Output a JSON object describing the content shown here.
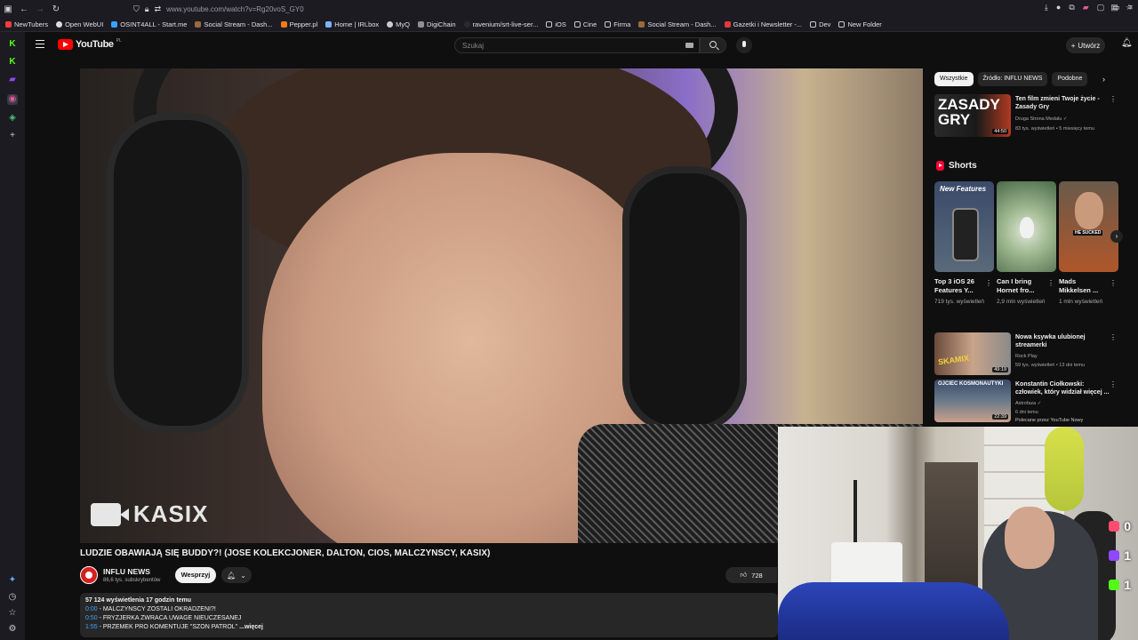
{
  "browser": {
    "url": "www.youtube.com/watch?v=Rg20voS_GY0",
    "bookmarks": [
      "NewTubers",
      "Open WebUI",
      "OSINT4ALL - Start.me",
      "Social Stream - Dash...",
      "Pepper.pl",
      "Home | IRLbox",
      "MyQ",
      "DigiChain",
      "ravenium/srt-live-ser...",
      "iOS",
      "Cine",
      "Firma",
      "Social Stream - Dash...",
      "Gazetki i Newsletter -...",
      "Dev",
      "New Folder"
    ],
    "colors": {
      "chrome_bg": "#1c1b22",
      "accent_red": "#ff0000",
      "link_blue": "#3ea6ff"
    }
  },
  "youtube": {
    "logo_text": "YouTube",
    "logo_country": "PL",
    "search_placeholder": "Szukaj",
    "create_label": "Utwórz",
    "icons": [
      "menu-icon",
      "search-icon",
      "microphone-icon",
      "plus-icon",
      "bell-icon",
      "keyboard-icon"
    ]
  },
  "video": {
    "watermark": "KASIX",
    "title": "LUDZIE OBAWIAJĄ SIĘ BUDDY?! (JOSE KOLEKCJONER, DALTON, CIOS, MALCZYNSCY, KASIX)",
    "channel_name": "INFLU NEWS",
    "subscribers": "86,6 tys. subskrybentów",
    "support_label": "Wesprzyj",
    "likes": "728",
    "description": {
      "stats": "57 124 wyświetlenia  17 godzin temu",
      "lines": [
        {
          "ts": "0:00",
          "text": " - MALCZYNSCY ZOSTALI OKRADZENI?!"
        },
        {
          "ts": "0:50",
          "text": " - FRYZJERKA ZWRACA UWAGE NIEUCZESANEJ"
        },
        {
          "ts": "1:55",
          "text": " - PRZEMEK PRO KOMENTUJE \"SZON PATROL\""
        }
      ],
      "more": " ...więcej"
    }
  },
  "sidebar": {
    "chips": [
      "Wszystkie",
      "Źródło: INFLU NEWS",
      "Podobne"
    ],
    "related_top": {
      "title": "Ten film zmieni Twoje życie - Zasady Gry",
      "channel": "Druga Strona Medalu",
      "meta": "83 tys. wyświetleń • 5 miesięcy temu",
      "duration": "44:50",
      "thumb_text": "ZASADY GRY"
    },
    "shorts_title": "Shorts",
    "shorts": [
      {
        "title": "Top 3 iOS 26 Features Y...",
        "views": "719 tys. wyświetleń",
        "thumb_text": "New Features"
      },
      {
        "title": "Can I bring Hornet fro...",
        "views": "2,9 mln wyświetleń",
        "thumb_text": ""
      },
      {
        "title": "Mads Mikkelsen ...",
        "views": "1 mln wyświetleń",
        "thumb_text": "HE SUCKED"
      }
    ],
    "related": [
      {
        "title": "Nowa ksywka ulubionej streamerki",
        "channel": "Rock Play",
        "meta": "59 tys. wyświetleń • 13 dni temu",
        "duration": "49:19",
        "thumb_text": "SKAMIX"
      },
      {
        "title": "Konstantin Ciołkowski: człowiek, który widział więcej ...",
        "channel": "Astrofaza",
        "meta": "6 dni temu",
        "badge": "Polecane przez YouTube  Nowy",
        "duration": "22:39",
        "thumb_text": "OJCIEC KOSMONAUTYKI"
      }
    ]
  },
  "overlay": {
    "stats": [
      {
        "platform": "youtube",
        "count": "0",
        "color": "#ff4b6e"
      },
      {
        "platform": "twitch",
        "count": "1",
        "color": "#9146ff"
      },
      {
        "platform": "kick",
        "count": "1",
        "color": "#53fc18"
      }
    ]
  }
}
